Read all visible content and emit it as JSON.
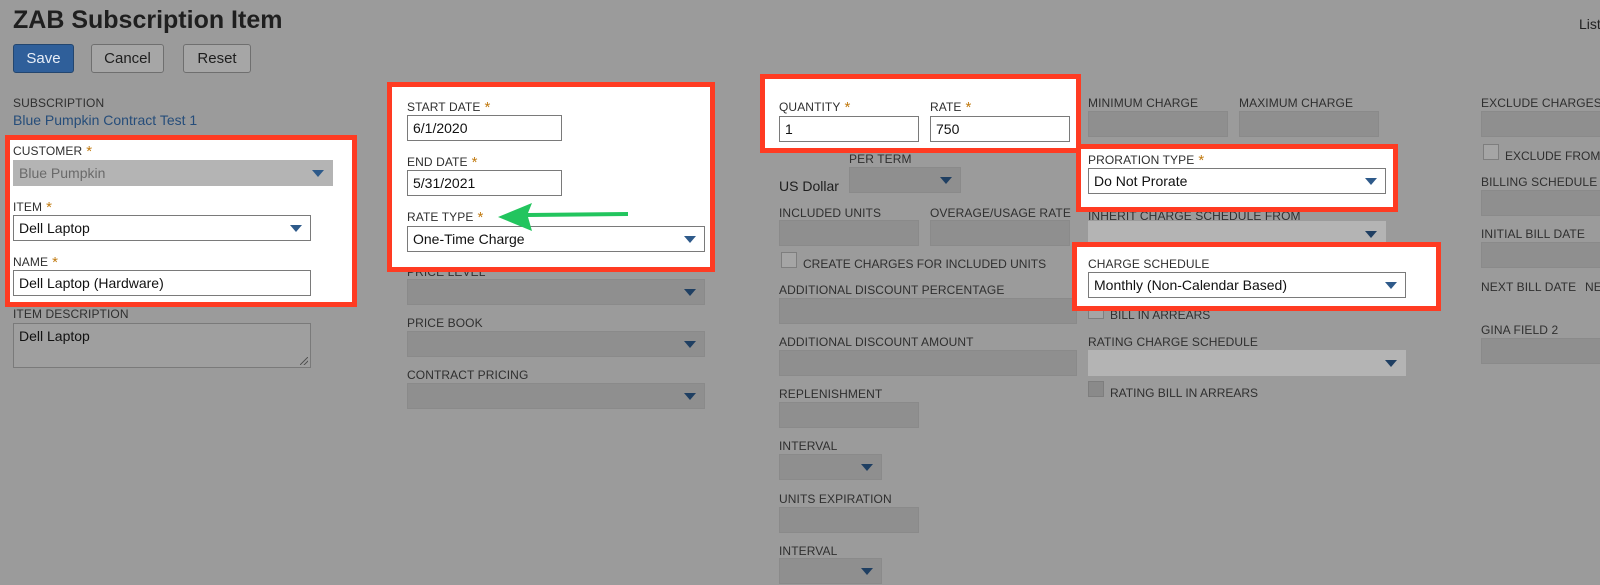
{
  "header": {
    "title": "ZAB Subscription Item",
    "top_right_link": "List"
  },
  "toolbar": {
    "save_label": "Save",
    "cancel_label": "Cancel",
    "reset_label": "Reset"
  },
  "col1": {
    "subscription_label": "SUBSCRIPTION",
    "subscription_value": "Blue Pumpkin Contract Test 1",
    "customer_label": "CUSTOMER",
    "customer_value": "Blue Pumpkin",
    "item_label": "ITEM",
    "item_value": "Dell Laptop",
    "name_label": "NAME",
    "name_value": "Dell Laptop (Hardware)",
    "item_description_label": "ITEM DESCRIPTION",
    "item_description_value": "Dell Laptop"
  },
  "col2": {
    "start_date_label": "START DATE",
    "start_date_value": "6/1/2020",
    "end_date_label": "END DATE",
    "end_date_value": "5/31/2021",
    "rate_type_label": "RATE TYPE",
    "rate_type_value": "One-Time Charge",
    "price_level_label": "PRICE LEVEL",
    "price_book_label": "PRICE BOOK",
    "contract_pricing_label": "CONTRACT PRICING"
  },
  "col3": {
    "quantity_label": "QUANTITY",
    "quantity_value": "1",
    "rate_label": "RATE",
    "rate_value": "750",
    "currency_text": "US Dollar",
    "per_term_label": "PER TERM",
    "included_units_label": "INCLUDED UNITS",
    "overage_rate_label": "OVERAGE/USAGE RATE",
    "create_charges_label": "CREATE CHARGES FOR INCLUDED UNITS",
    "additional_discount_pct_label": "ADDITIONAL DISCOUNT PERCENTAGE",
    "additional_discount_amt_label": "ADDITIONAL DISCOUNT AMOUNT",
    "replenishment_label": "REPLENISHMENT",
    "interval_label": "INTERVAL",
    "units_expiration_label": "UNITS EXPIRATION",
    "interval2_label": "INTERVAL"
  },
  "col4": {
    "minimum_charge_label": "MINIMUM CHARGE",
    "maximum_charge_label": "MAXIMUM CHARGE",
    "proration_type_label": "PRORATION TYPE",
    "proration_type_value": "Do Not Prorate",
    "inherit_schedule_label": "INHERIT CHARGE SCHEDULE FROM",
    "charge_schedule_label": "CHARGE SCHEDULE",
    "charge_schedule_value": "Monthly (Non-Calendar Based)",
    "bill_in_arrears_label": "BILL IN ARREARS",
    "rating_charge_schedule_label": "RATING CHARGE SCHEDULE",
    "rating_bill_in_arrears_label": "RATING BILL IN ARREARS"
  },
  "col5": {
    "exclude_charges_label": "EXCLUDE CHARGES",
    "exclude_from_label": "EXCLUDE FROM",
    "billing_schedule_label": "BILLING SCHEDULE",
    "initial_bill_date_label": "INITIAL BILL DATE",
    "next_bill_date_label": "NEXT BILL DATE",
    "next_bill_date_value": "NE",
    "gina_field_label": "GINA FIELD 2"
  },
  "colors": {
    "highlight_border": "#ff3b22",
    "arrow": "#22c55e",
    "primary_button": "#2f5f9a",
    "required_star": "#c17a10"
  }
}
